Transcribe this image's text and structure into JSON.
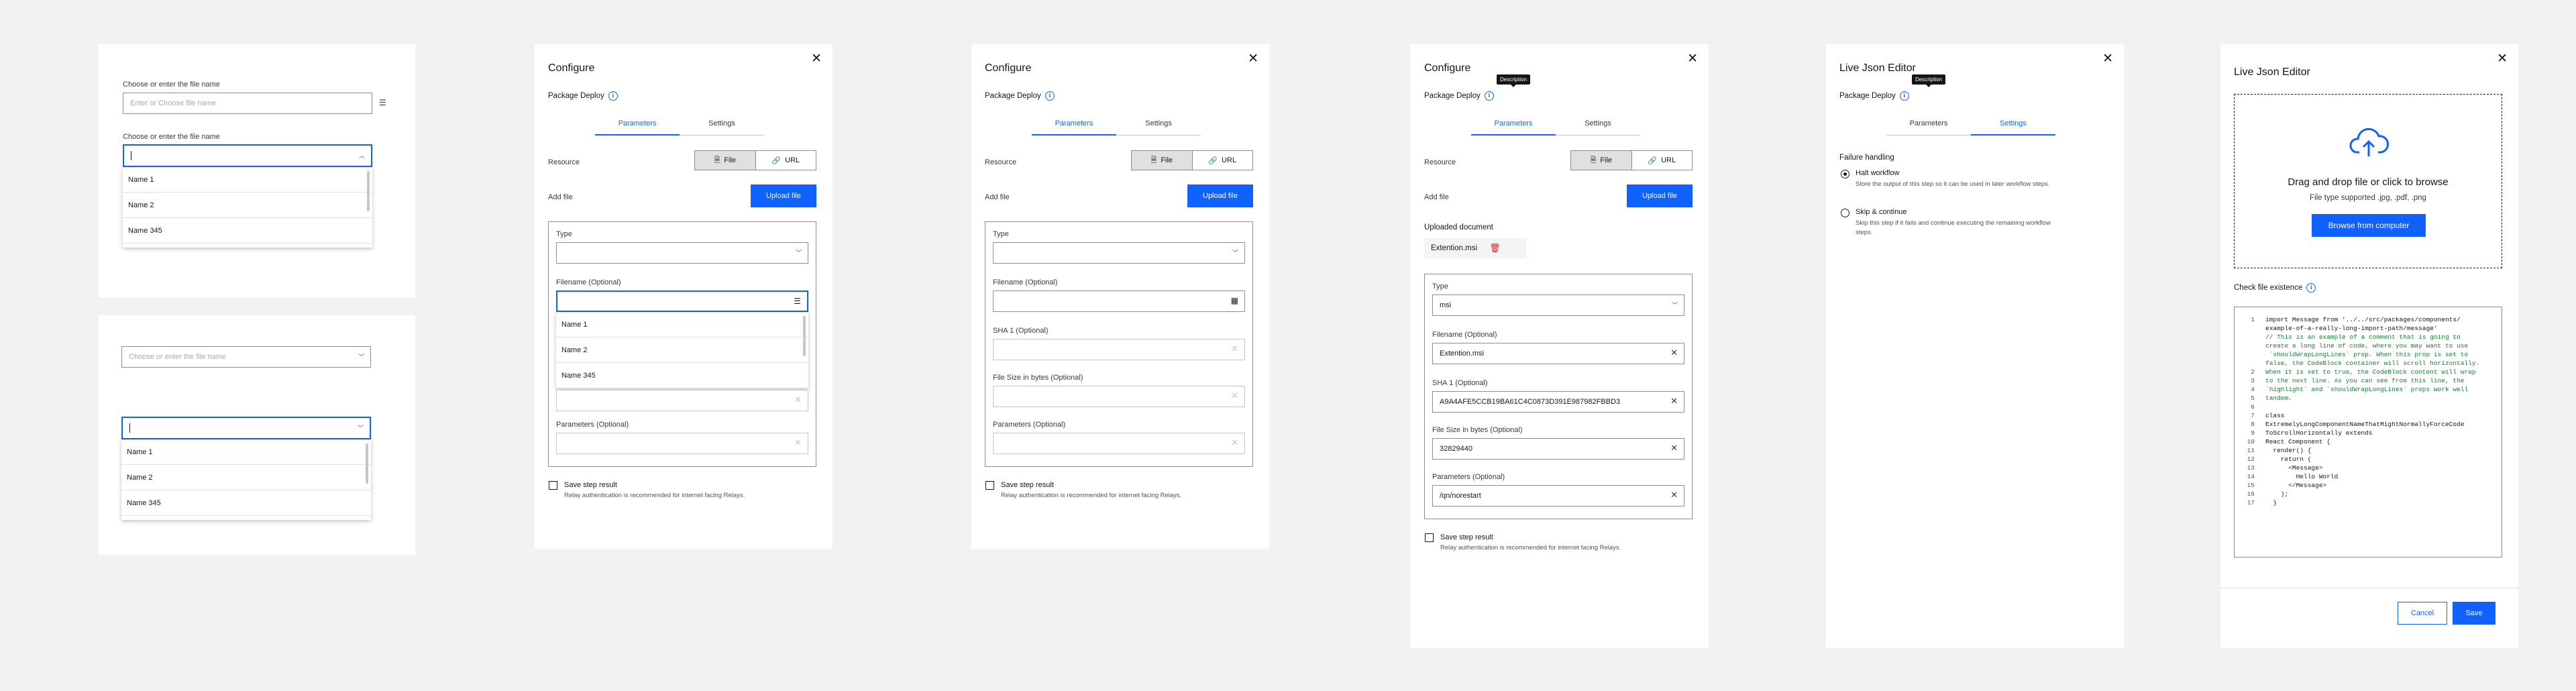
{
  "colors": {
    "accent": "#0f62fe",
    "danger": "#da1e28",
    "canvas": "#f2f2f2"
  },
  "panel1": {
    "label1": "Choose or enter the  file name",
    "placeholder1": "Enter or Choose file name",
    "label2": "Choose or enter the  file name",
    "items": [
      "Name 1",
      "Name 2",
      "Name 345"
    ]
  },
  "panel2": {
    "placeholder": "Choose or enter the  file name",
    "items": [
      "Name 1",
      "Name 2",
      "Name 345"
    ]
  },
  "configure": {
    "title": "Configure",
    "package": "Package Deploy",
    "tabs": [
      "Parameters",
      "Settings"
    ],
    "resource": "Resource",
    "file": "File",
    "url": "URL",
    "add_file": "Add file",
    "upload": "Upload file",
    "type": "Type",
    "filename": "Filename (Optional)",
    "sha": "SHA 1 (Optional)",
    "size": "File Size in bytes (Optional)",
    "params": "Parameters (Optional)",
    "save": "Save step result",
    "relay": "Relay authentication is recommended for internet facing Relays.",
    "menu_items": [
      "Name 1",
      "Name 2",
      "Name 345"
    ],
    "tooltip": "Description"
  },
  "upload_doc": {
    "uploaded": "Uploaded document",
    "filename": "Extention.msi",
    "type_value": "msi",
    "filename_value": "Extention.msi",
    "sha_value": "A9A4AFE5CCB19BA61C4C0873D391E987982FBBD3",
    "size_value": "32829440",
    "params_value": "/qn/norestart"
  },
  "live1": {
    "title": "Live Json Editor",
    "failure": "Failure handling",
    "halt": "Halt workflow",
    "halt_desc": "Store the output of this step so it can be used in later workflow steps.",
    "skip": "Skip & continue",
    "skip_desc": "Skip this step if it fails and continue executing the remaining workflow steps."
  },
  "live2": {
    "title": "Live Json Editor",
    "drop": "Drag and drop file or click to browse",
    "types": "File type supported .jpg, .pdf, .png",
    "browse": "Browse from computer",
    "check": "Check file existence",
    "cancel": "Cancel",
    "save": "Save",
    "code": [
      {
        "n": "1",
        "t": "import Message from '../../src/packages/components/",
        "c": false
      },
      {
        "n": "",
        "t": "example-of-a-really-long-import-path/message'",
        "c": false
      },
      {
        "n": "",
        "t": "",
        "c": false
      },
      {
        "n": "",
        "t": "// This is an example of a comment that is going to",
        "c": true
      },
      {
        "n": "",
        "t": "create a long line of code, where you may want to use",
        "c": true
      },
      {
        "n": "",
        "t": " `shouldWrapLongLines` prop. When this prop is set to",
        "c": true
      },
      {
        "n": "",
        "t": "false, the CodeBlock container will scroll horizontally.",
        "c": true
      },
      {
        "n": "2",
        "t": "When it is set to true, the CodeBlock content will wrap",
        "c": true
      },
      {
        "n": "3",
        "t": "to the next line. As you can see from this line, the",
        "c": true
      },
      {
        "n": "4",
        "t": "`highlight` and `shouldWrapLongLines` props work well",
        "c": true
      },
      {
        "n": "5",
        "t": "tandem.",
        "c": true
      },
      {
        "n": "6",
        "t": "",
        "c": false
      },
      {
        "n": "7",
        "t": "class",
        "c": false
      },
      {
        "n": "8",
        "t": "ExtremelyLongComponentNameThatMightNormallyForceCode",
        "c": false
      },
      {
        "n": "9",
        "t": "ToScrollHorizontally extends",
        "c": false
      },
      {
        "n": "10",
        "t": "React Component {",
        "c": false
      },
      {
        "n": "11",
        "t": "  render() {",
        "c": false
      },
      {
        "n": "12",
        "t": "    return (",
        "c": false
      },
      {
        "n": "13",
        "t": "      <Message>",
        "c": false
      },
      {
        "n": "14",
        "t": "        Hello World",
        "c": false
      },
      {
        "n": "15",
        "t": "      </Message>",
        "c": false
      },
      {
        "n": "16",
        "t": "    );",
        "c": false
      },
      {
        "n": "17",
        "t": "  }",
        "c": false
      }
    ]
  }
}
